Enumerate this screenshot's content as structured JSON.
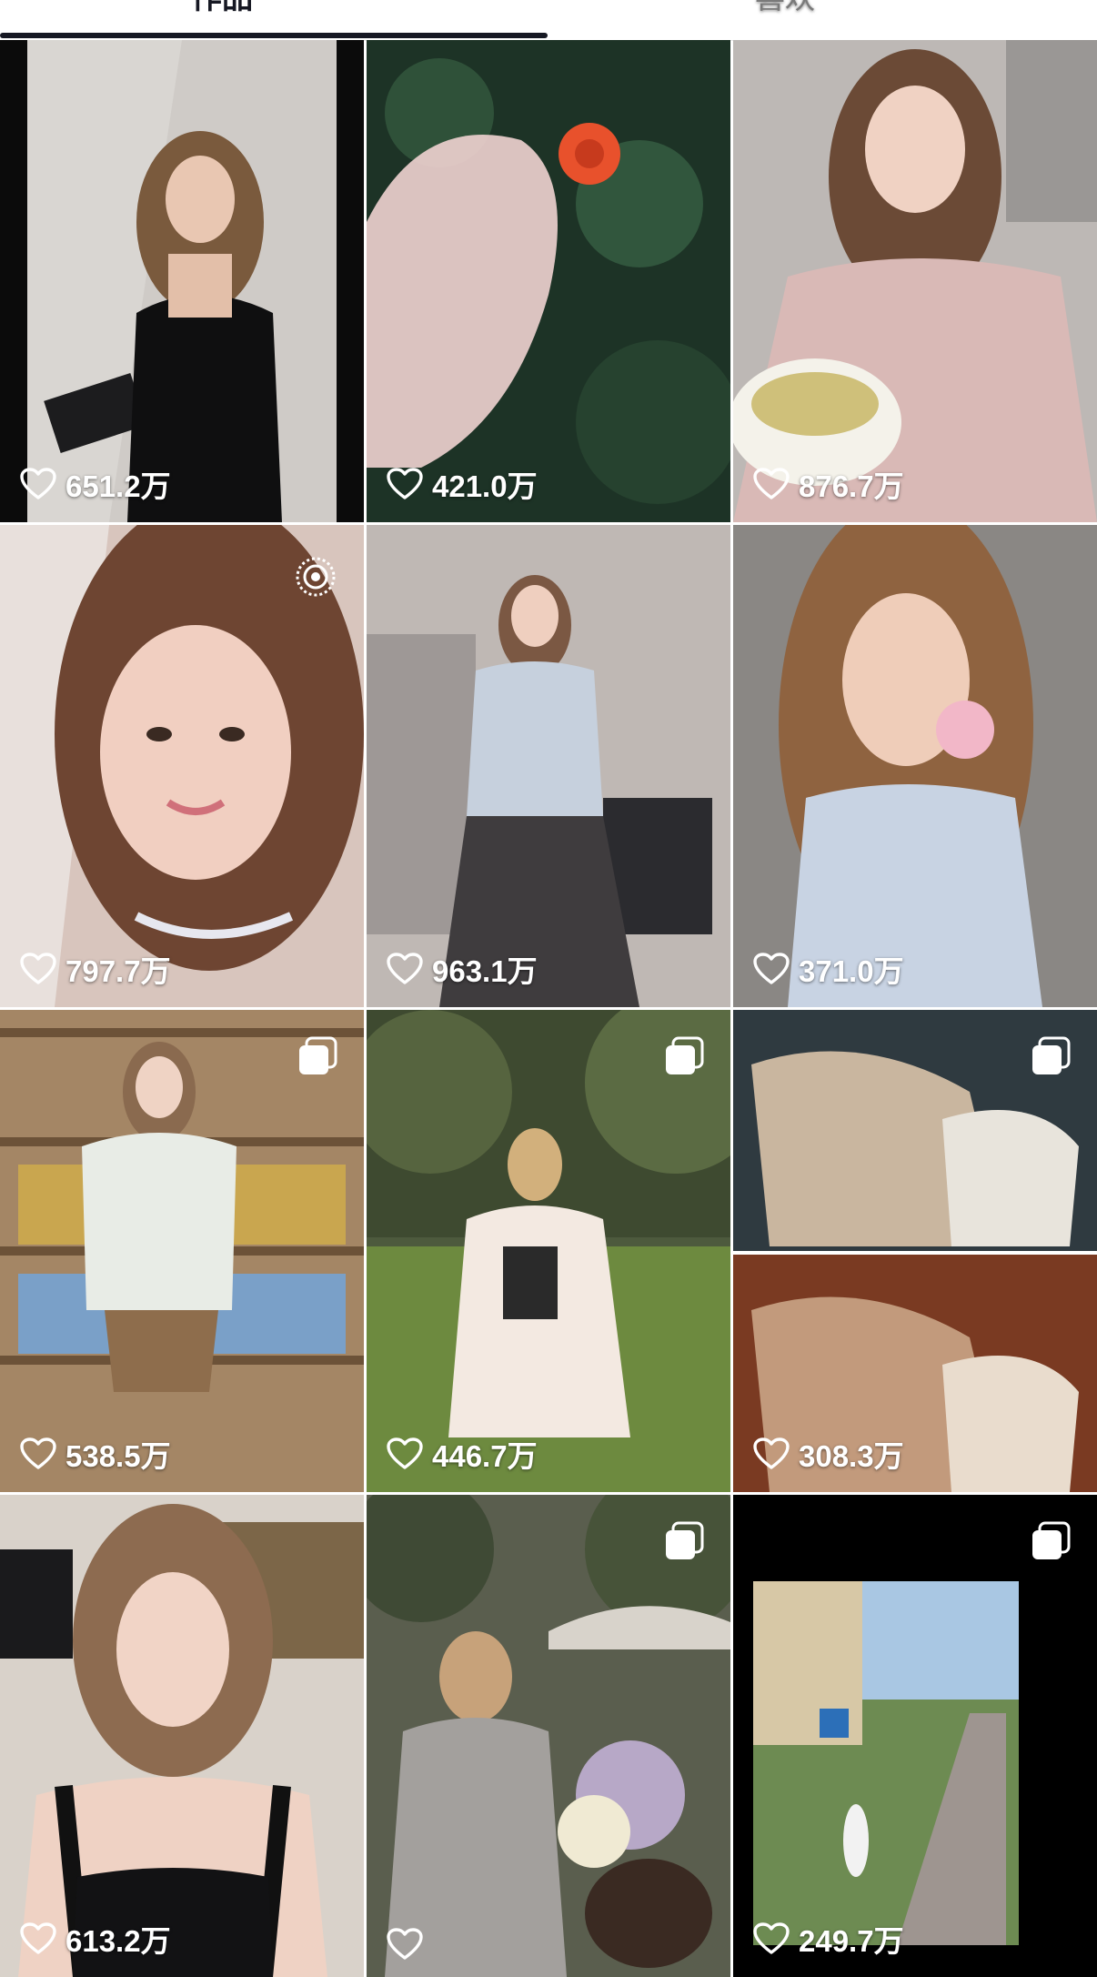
{
  "tabs": [
    {
      "label": "作品"
    },
    {
      "label": "喜欢"
    }
  ],
  "colors": {
    "text": "#161823",
    "like_text": "#ffffff",
    "indicator": "#161823"
  },
  "grid": {
    "items": [
      {
        "likes": "651.2万",
        "badge": null
      },
      {
        "likes": "421.0万",
        "badge": null
      },
      {
        "likes": "876.7万",
        "badge": null
      },
      {
        "likes": "797.7万",
        "badge": "live-photo-icon"
      },
      {
        "likes": "963.1万",
        "badge": null
      },
      {
        "likes": "371.0万",
        "badge": null
      },
      {
        "likes": "538.5万",
        "badge": "gallery-icon"
      },
      {
        "likes": "446.7万",
        "badge": "gallery-icon"
      },
      {
        "likes": "308.3万",
        "badge": "gallery-icon"
      },
      {
        "likes": "613.2万",
        "badge": null
      },
      {
        "likes": "",
        "badge": "gallery-icon"
      },
      {
        "likes": "249.7万",
        "badge": "gallery-icon"
      }
    ]
  }
}
